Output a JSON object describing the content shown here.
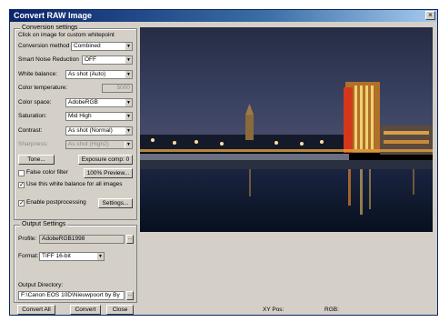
{
  "window": {
    "title": "Convert RAW Image",
    "close_glyph": "×"
  },
  "conversion": {
    "group_title": "Conversion settings",
    "hint": "Click on image for custom whitepoint",
    "rows": {
      "method": {
        "label": "Conversion method",
        "value": "Combined"
      },
      "noise": {
        "label": "Smart Noise Reduction",
        "value": "OFF"
      },
      "wb": {
        "label": "White balance:",
        "value": "As shot (Auto)"
      },
      "temp": {
        "label": "Color temperature:",
        "value": "5000"
      },
      "space": {
        "label": "Color space:",
        "value": "AdobeRGB"
      },
      "saturation": {
        "label": "Saturation:",
        "value": "Mid High"
      },
      "contrast": {
        "label": "Contrast:",
        "value": "As shot (Normal)"
      },
      "sharpness": {
        "label": "Sharpness:",
        "value": "As shot (High2)"
      }
    },
    "tone_button": "Tone...",
    "exposure_button": "Exposure comp: 0",
    "false_color_label": "False color filter",
    "preview_button": "100% Preview...",
    "use_wb_label": "Use this white balance for all images",
    "postprocessing_label": "Enable postprocessing",
    "settings_button": "Settings..."
  },
  "output": {
    "group_title": "Output Settings",
    "profile_label": "Profile:",
    "profile_value": "AdobeRGB1998",
    "format_label": "Format:",
    "format_value": "TIFF 16-bit",
    "directory_label": "Output Directory:",
    "directory_value": "F:\\Canon EOS 10D\\Nieuwpoort by By"
  },
  "buttons": {
    "convert_all": "Convert All",
    "convert": "Convert",
    "close": "Close"
  },
  "status": {
    "xy_pos": "XY Pos:",
    "rgb": "RGB:"
  },
  "checks": {
    "false_color": false,
    "use_wb": true,
    "postprocessing": true
  },
  "colors": {
    "title_bar": "#0a246a",
    "dialog_bg": "#d4d0c8",
    "sky": "#343c58",
    "water": "#0c1828"
  }
}
